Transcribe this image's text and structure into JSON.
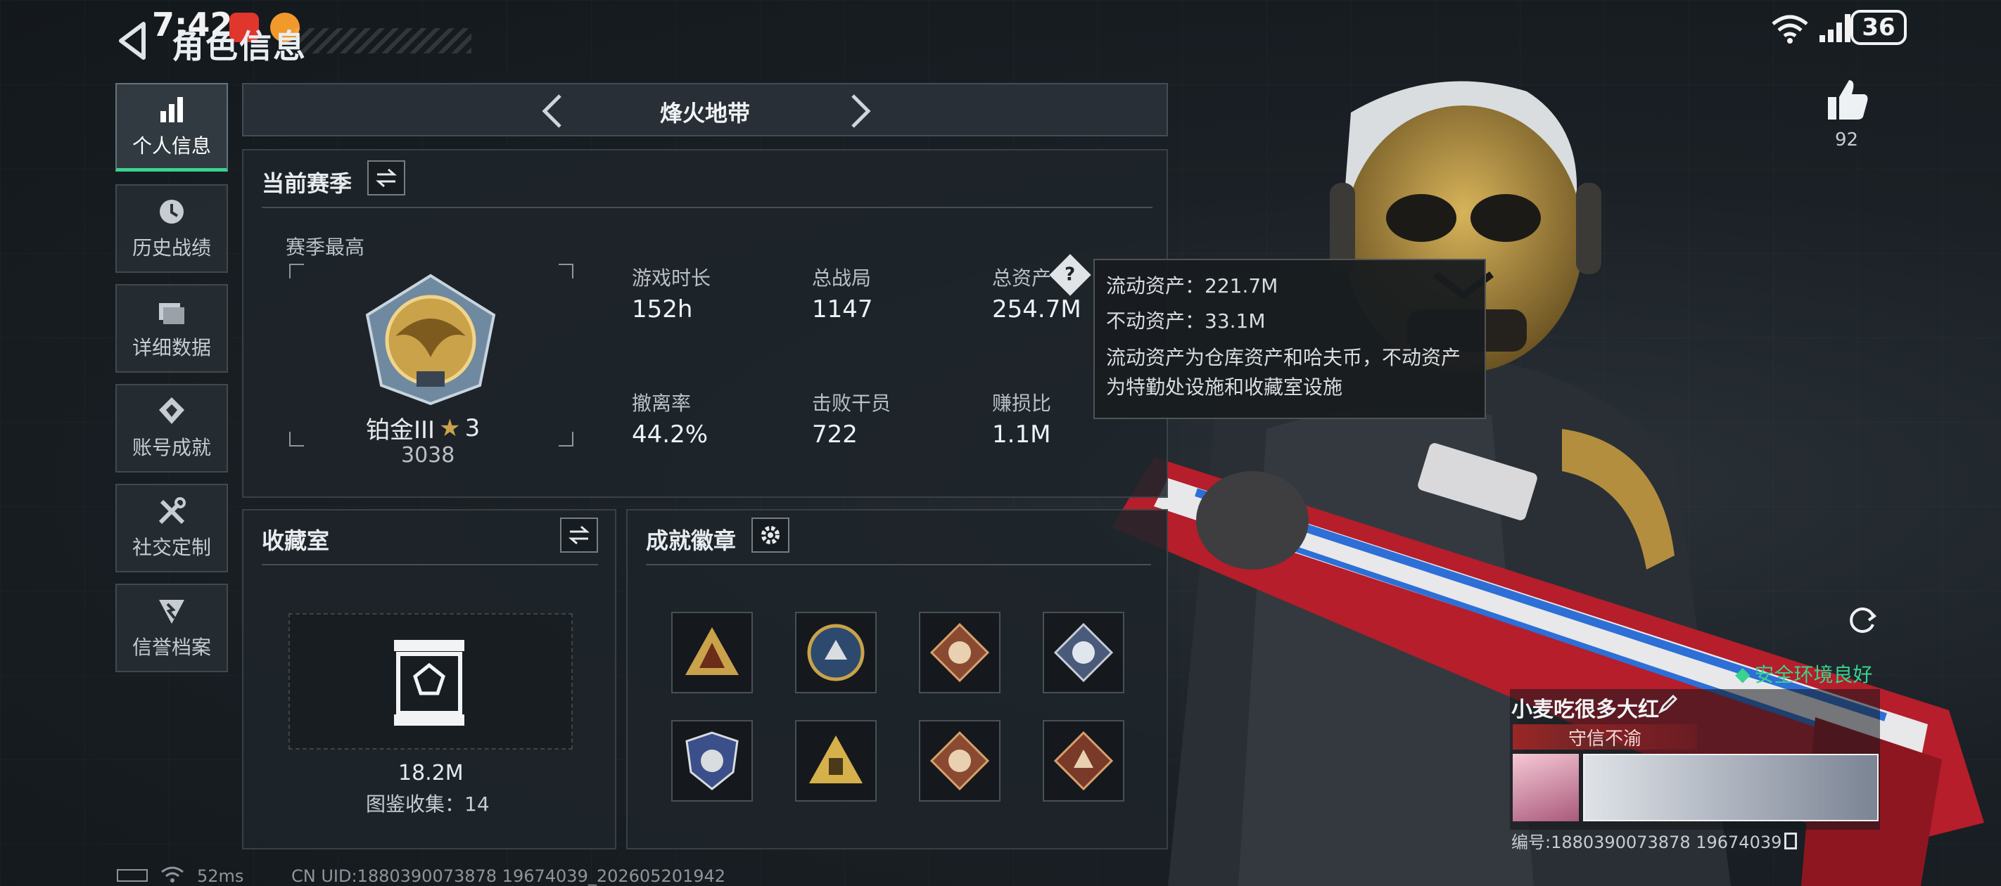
{
  "status_bar": {
    "time": "7:42",
    "battery": "36",
    "ping": "52ms"
  },
  "header": {
    "title": "角色信息"
  },
  "sidebar": {
    "items": [
      {
        "label": "个人信息",
        "icon": "bar-chart-icon",
        "active": true
      },
      {
        "label": "历史战绩",
        "icon": "history-icon"
      },
      {
        "label": "详细数据",
        "icon": "folder-icon"
      },
      {
        "label": "账号成就",
        "icon": "achievement-icon"
      },
      {
        "label": "社交定制",
        "icon": "tools-icon"
      },
      {
        "label": "信誉档案",
        "icon": "reputation-icon"
      }
    ]
  },
  "mode_switch": {
    "title": "烽火地带"
  },
  "season": {
    "title": "当前赛季",
    "peak_label": "赛季最高",
    "rank_name": "铂金III",
    "rank_stars": "3",
    "rank_score": "3038",
    "stats": [
      {
        "label": "游戏时长",
        "value": "152h"
      },
      {
        "label": "总战局",
        "value": "1147"
      },
      {
        "label": "总资产",
        "value": "254.7M"
      },
      {
        "label": "撤离率",
        "value": "44.2%"
      },
      {
        "label": "击败干员",
        "value": "722"
      },
      {
        "label": "赚损比",
        "value": "1.1M"
      }
    ]
  },
  "asset_tooltip": {
    "liquid": "流动资产：221.7M",
    "fixed": "不动资产：33.1M",
    "desc_line1": "流动资产为仓库资产和哈夫币，不动资产",
    "desc_line2": "为特勤处设施和收藏室设施"
  },
  "collection": {
    "title": "收藏室",
    "value": "18.2M",
    "count_text": "图鉴收集：14"
  },
  "achievements": {
    "title": "成就徽章",
    "badges": [
      "triangle-badge-icon",
      "wolf-coin-badge-icon",
      "dragon-diamond-badge-icon",
      "silver-diamond-badge-icon",
      "shield-badge-icon",
      "gold-triangle-badge-icon",
      "dragon-diamond-badge-icon",
      "wolf-diamond-badge-icon"
    ]
  },
  "likes": {
    "count": "92"
  },
  "profile": {
    "safety": "安全环境良好",
    "name": "小麦吃很多大红",
    "title_tag": "守信不渝",
    "id_text": "编号:1880390073878 19674039"
  },
  "footer": {
    "uid": "CN UID:1880390073878 19674039_202605201942"
  },
  "colors": {
    "accent_green": "#39d28f",
    "tag_red": "#9b2626",
    "gold": "#c9a24a"
  }
}
